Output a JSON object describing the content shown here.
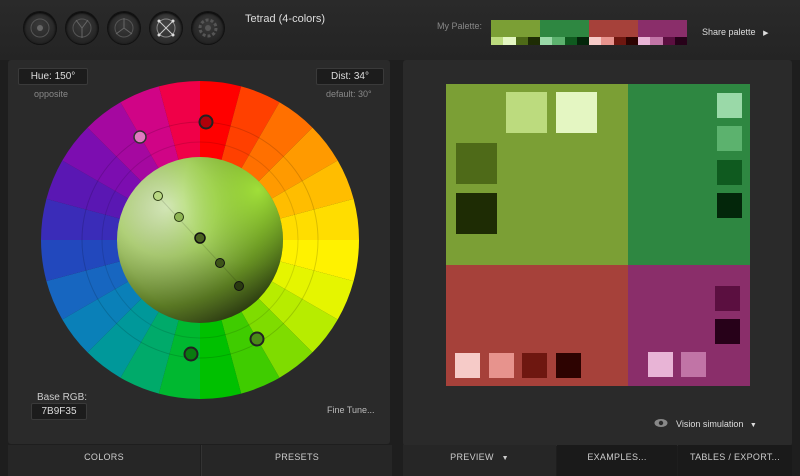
{
  "header": {
    "scheme_title": "Tetrad (4-colors)",
    "palette_label": "My Palette:",
    "share_label": "Share palette",
    "share_icon": "chevron-right-icon",
    "modes": [
      {
        "name": "mono-icon"
      },
      {
        "name": "adjacent-icon"
      },
      {
        "name": "triad-icon"
      },
      {
        "name": "tetrad-icon",
        "active": true
      },
      {
        "name": "freestyle-icon"
      }
    ]
  },
  "palette": {
    "groups": [
      {
        "main": "#7B9F35",
        "shades": [
          "#BCDB7E",
          "#E4F6C2",
          "#4E6A18",
          "#1E2C04"
        ]
      },
      {
        "main": "#2E8741",
        "shades": [
          "#9AD9A8",
          "#5CB26E",
          "#0F5A1F",
          "#03260A"
        ]
      },
      {
        "main": "#A6413A",
        "shades": [
          "#F6CBC8",
          "#E7938D",
          "#6E1710",
          "#2D0301"
        ]
      },
      {
        "main": "#8A2E6A",
        "shades": [
          "#E8B4D6",
          "#C174A6",
          "#5B0F40",
          "#270119"
        ]
      }
    ]
  },
  "wheel": {
    "hue_label": "Hue: 150°",
    "hue_note": "opposite",
    "dist_label": "Dist: 34°",
    "dist_note": "default: 30°",
    "base_rgb_label": "Base RGB:",
    "base_rgb_value": "7B9F35",
    "fine_tune_label": "Fine Tune..."
  },
  "vision": {
    "label": "Vision simulation",
    "icon": "eye-icon",
    "dropdown_icon": "caret-down-icon"
  },
  "tabs": {
    "colors": "COLORS",
    "presets": "PRESETS",
    "preview": "PREVIEW",
    "examples": "EXAMPLES...",
    "tables": "TABLES / EXPORT..."
  }
}
